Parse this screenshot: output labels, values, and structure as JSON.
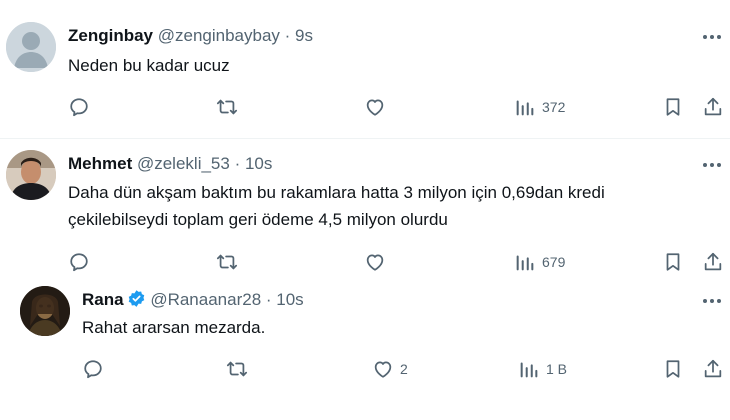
{
  "tweets": [
    {
      "display_name": "Zenginbay",
      "handle": "@zenginbaybay",
      "time": "· 9s",
      "text_lines": [
        "Neden bu kadar ucuz"
      ],
      "views": "372",
      "likes": "",
      "avatar": "default-avatar"
    },
    {
      "display_name": "Mehmet",
      "handle": "@zelekli_53",
      "time": "· 10s",
      "text_lines": [
        "Daha dün akşam baktım bu rakamlara hatta 3 milyon için 0,69dan kredi",
        "çekilebilseydi toplam geri ödeme 4,5 milyon olurdu"
      ],
      "views": "679",
      "likes": "",
      "avatar": "photo-avatar"
    },
    {
      "display_name": "Rana",
      "handle": "@Ranaanar28",
      "time": "· 10s",
      "text_lines": [
        "Rahat ararsan mezarda."
      ],
      "views": "1 B",
      "likes": "2",
      "avatar": "photo-avatar",
      "verified": true
    }
  ],
  "colors": {
    "text": "#0f1419",
    "secondary": "#536471",
    "verified": "#1d9bf0",
    "divider": "#eff3f4"
  },
  "icons": [
    "reply-icon",
    "retweet-icon",
    "like-icon",
    "views-icon",
    "bookmark-icon",
    "share-icon",
    "more-icon",
    "verified-badge-icon"
  ]
}
